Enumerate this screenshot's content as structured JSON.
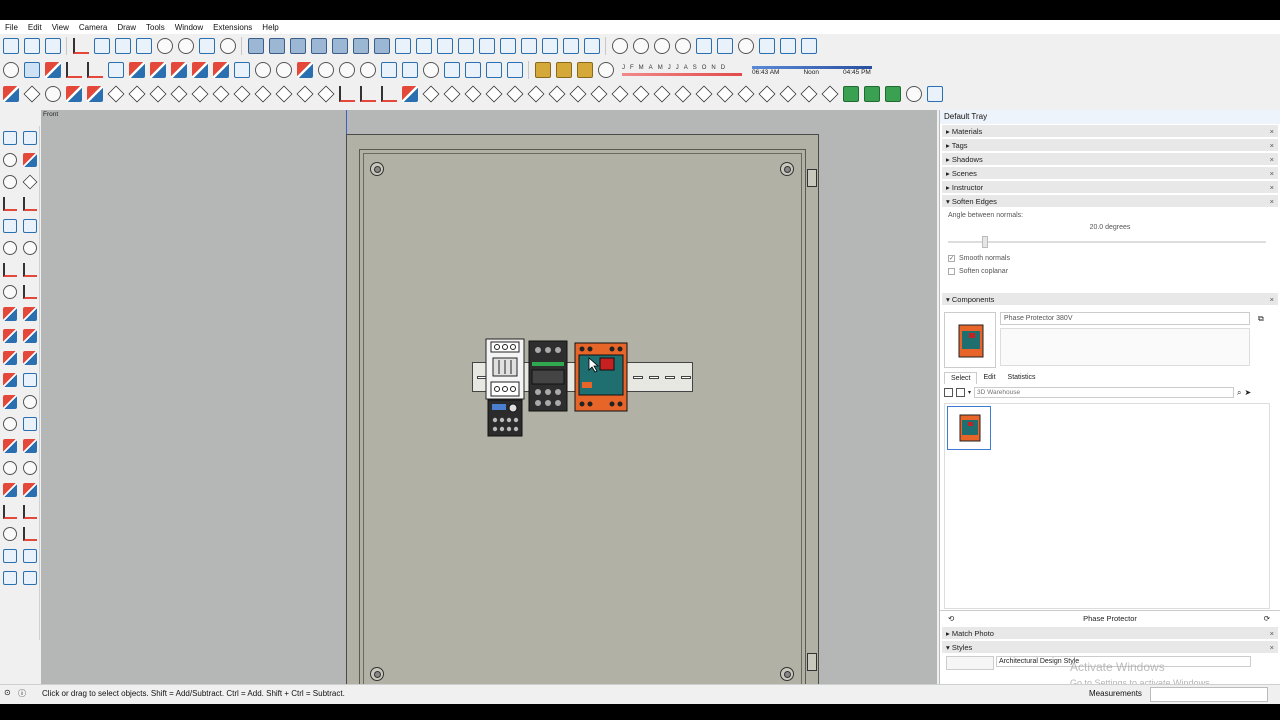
{
  "menu": [
    "File",
    "Edit",
    "View",
    "Camera",
    "Draw",
    "Tools",
    "Window",
    "Extensions",
    "Help"
  ],
  "shadow_bar": {
    "months": [
      "J",
      "F",
      "M",
      "A",
      "M",
      "J",
      "J",
      "A",
      "S",
      "O",
      "N",
      "D"
    ],
    "time_start": "06:43 AM",
    "time_mid": "Noon",
    "time_end": "04:45 PM"
  },
  "viewport": {
    "view_label": "Front"
  },
  "tray": {
    "title": "Default Tray",
    "sections_top": [
      "Materials",
      "Tags",
      "Shadows",
      "Scenes",
      "Instructor"
    ],
    "soften": {
      "title": "Soften Edges",
      "angle_label": "Angle between normals:",
      "angle_value": "20.0  degrees",
      "smooth_label": "Smooth normals",
      "coplanar_label": "Soften coplanar"
    },
    "components": {
      "title": "Components",
      "name": "Phase Protector 380V",
      "tabs": [
        "Select",
        "Edit",
        "Statistics"
      ],
      "search_placeholder": "3D Warehouse",
      "footer_name": "Phase Protector"
    },
    "match_photo": "Match Photo",
    "styles": {
      "title": "Styles",
      "style_name": "Architectural Design Style"
    }
  },
  "status": {
    "message": "Click or drag to select objects. Shift = Add/Subtract. Ctrl = Add. Shift + Ctrl = Subtract.",
    "measurements_label": "Measurements"
  },
  "watermark": {
    "line1": "Activate Windows",
    "line2": "Go to Settings to activate Windows."
  },
  "colors": {
    "accent": "#2a6fb0",
    "viewport_bg": "#b5b7b6",
    "panel": "#b1b1a6",
    "relay_orange": "#e8652a"
  }
}
